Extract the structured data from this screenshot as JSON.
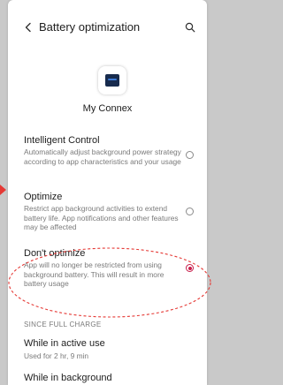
{
  "header": {
    "title": "Battery optimization",
    "back_icon": "chevron-left-icon",
    "search_icon": "search-icon"
  },
  "app": {
    "name": "My Connex",
    "icon": "my-connex-app-icon",
    "icon_color": "#172b4d"
  },
  "options": [
    {
      "title": "Intelligent Control",
      "description": "Automatically adjust background power strategy according to app characteristics and your usage",
      "selected": false
    },
    {
      "title": "Optimize",
      "description": "Restrict app background activities to extend battery life. App notifications and other features may be affected",
      "selected": false
    },
    {
      "title": "Don't optimize",
      "description": "App will no longer be restricted from using background battery. This will result in more battery usage",
      "selected": true
    }
  ],
  "section": {
    "header": "SINCE FULL CHARGE",
    "stats": [
      {
        "title": "While in active use",
        "value": "Used for 2 hr, 9 min"
      },
      {
        "title": "While in background",
        "value": ""
      }
    ]
  },
  "colors": {
    "accent": "#c81e4b",
    "annotation": "#e53935"
  }
}
